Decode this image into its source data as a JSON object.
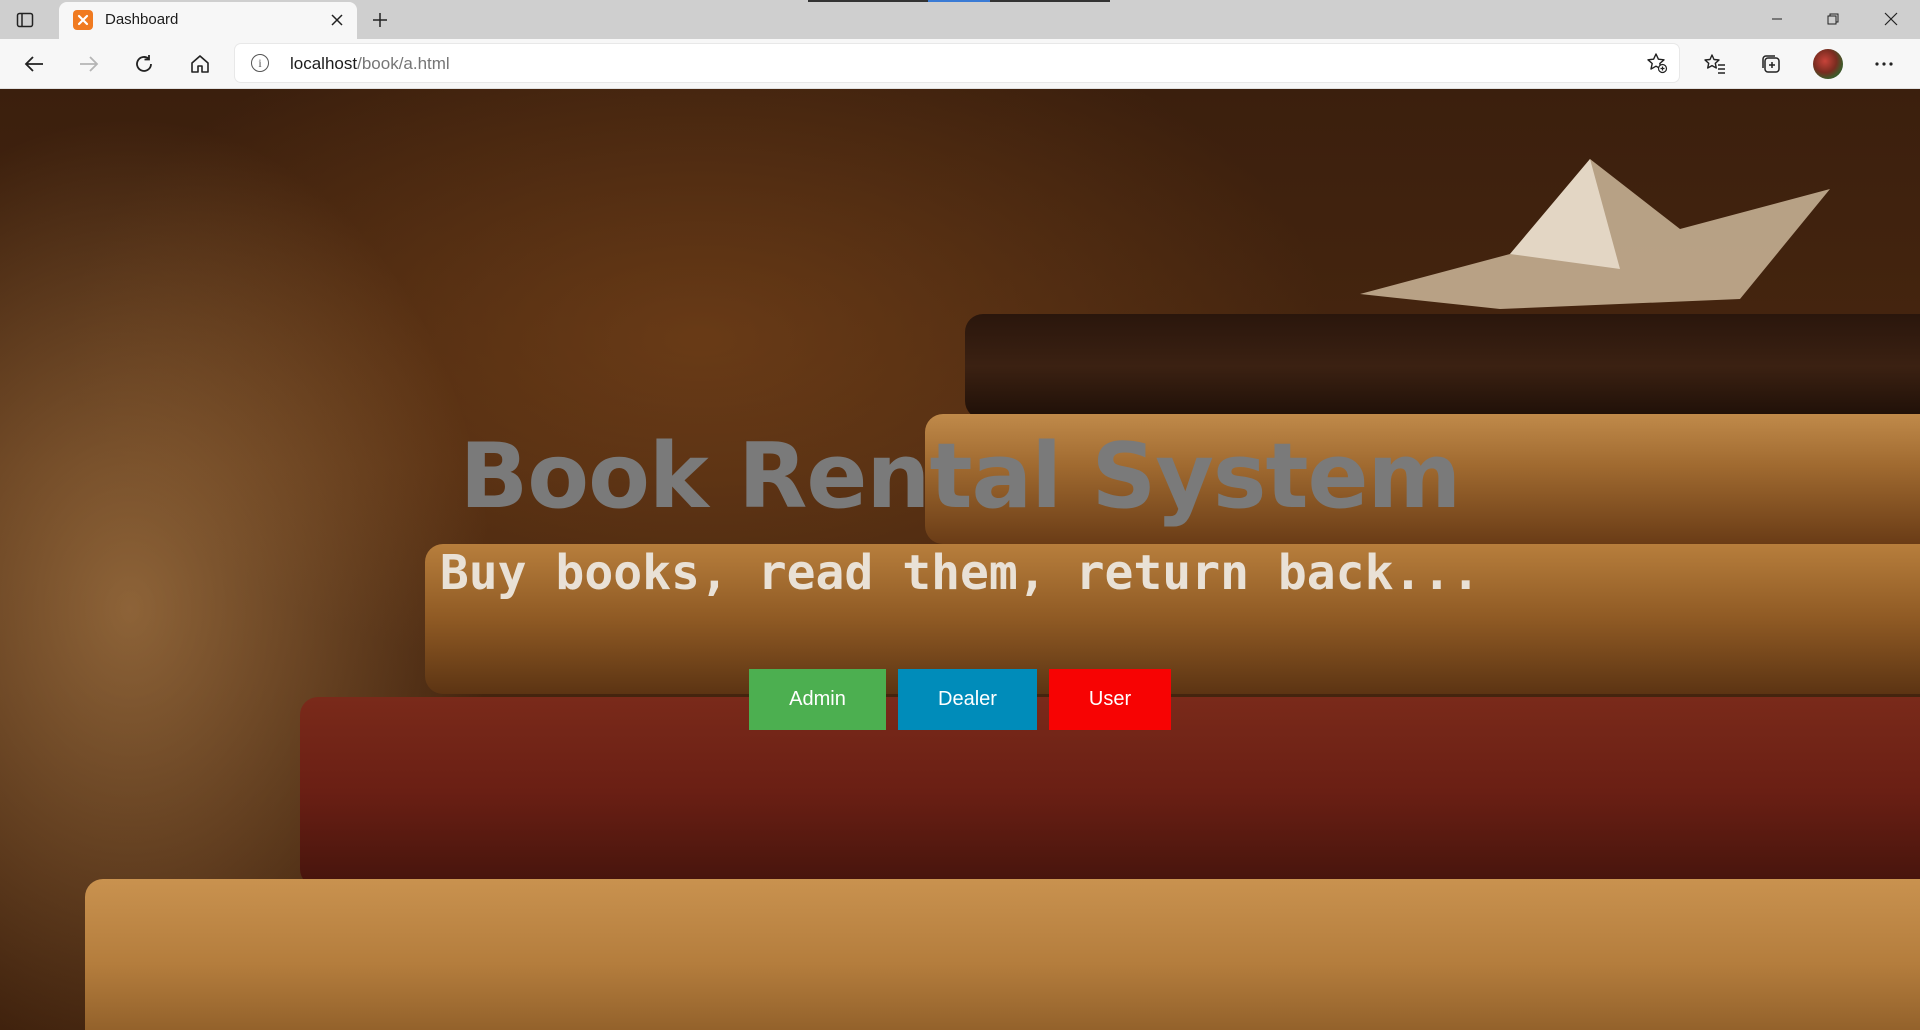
{
  "browser": {
    "tab_title": "Dashboard",
    "url_host": "localhost",
    "url_path": "/book/a.html"
  },
  "hero": {
    "title": "Book Rental System",
    "subtitle": "Buy books, read them, return back..."
  },
  "buttons": [
    {
      "label": "Admin",
      "color": "#4caf50"
    },
    {
      "label": "Dealer",
      "color": "#008cba"
    },
    {
      "label": "User",
      "color": "#f70303"
    }
  ],
  "icons": [
    "tab-actions-icon",
    "close-icon",
    "plus-icon",
    "back-arrow-icon",
    "forward-arrow-icon",
    "refresh-icon",
    "home-icon",
    "info-icon",
    "add-favorite-icon",
    "favorites-icon",
    "collections-icon",
    "more-icon",
    "minimize-icon",
    "restore-icon",
    "window-close-icon"
  ]
}
